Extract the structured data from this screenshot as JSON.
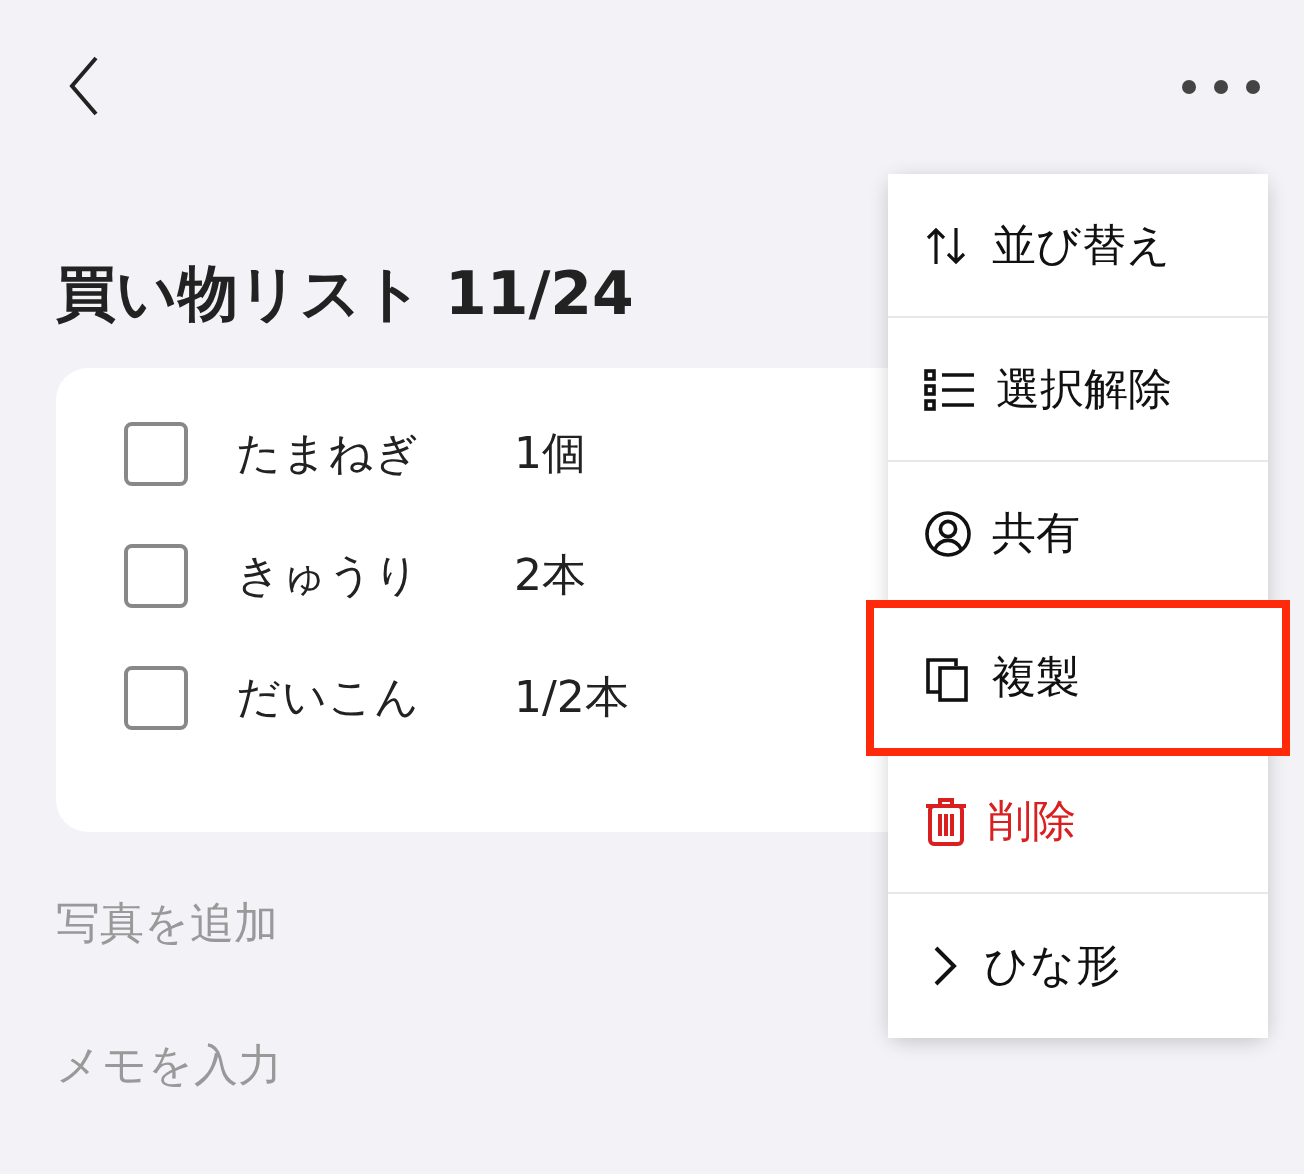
{
  "title": "買い物リスト 11/24",
  "items": [
    {
      "name": "たまねぎ",
      "quantity": "1個",
      "checked": false
    },
    {
      "name": "きゅうり",
      "quantity": "2本",
      "checked": false
    },
    {
      "name": "だいこん",
      "quantity": "1/2本",
      "checked": false
    }
  ],
  "add_photo": "写真を追加",
  "memo": {
    "placeholder": "メモを入力"
  },
  "menu": [
    {
      "kind": "sort",
      "label": "並び替え",
      "highlighted": false
    },
    {
      "kind": "deselect",
      "label": "選択解除",
      "highlighted": false
    },
    {
      "kind": "share",
      "label": "共有",
      "highlighted": false
    },
    {
      "kind": "duplicate",
      "label": "複製",
      "highlighted": true
    },
    {
      "kind": "delete",
      "label": "削除",
      "highlighted": false
    },
    {
      "kind": "template",
      "label": "ひな形",
      "highlighted": false
    }
  ]
}
